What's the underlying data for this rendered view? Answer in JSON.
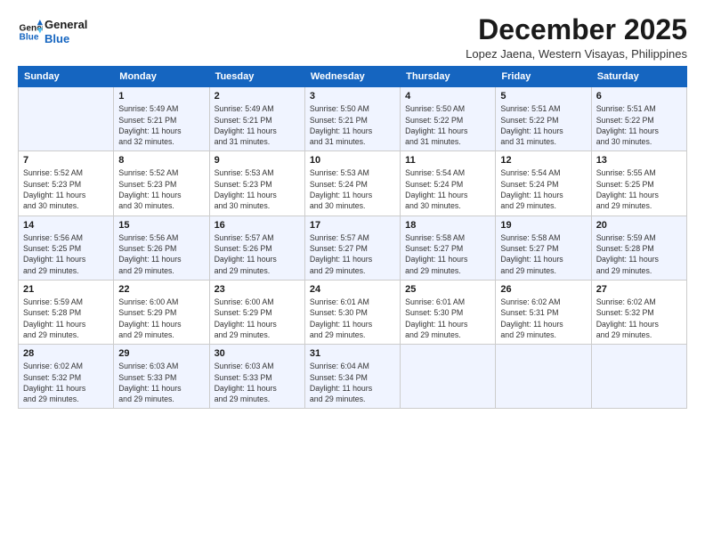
{
  "header": {
    "logo_line1": "General",
    "logo_line2": "Blue",
    "main_title": "December 2025",
    "subtitle": "Lopez Jaena, Western Visayas, Philippines"
  },
  "calendar": {
    "days_of_week": [
      "Sunday",
      "Monday",
      "Tuesday",
      "Wednesday",
      "Thursday",
      "Friday",
      "Saturday"
    ],
    "weeks": [
      [
        {
          "day": "",
          "info": ""
        },
        {
          "day": "1",
          "info": "Sunrise: 5:49 AM\nSunset: 5:21 PM\nDaylight: 11 hours\nand 32 minutes."
        },
        {
          "day": "2",
          "info": "Sunrise: 5:49 AM\nSunset: 5:21 PM\nDaylight: 11 hours\nand 31 minutes."
        },
        {
          "day": "3",
          "info": "Sunrise: 5:50 AM\nSunset: 5:21 PM\nDaylight: 11 hours\nand 31 minutes."
        },
        {
          "day": "4",
          "info": "Sunrise: 5:50 AM\nSunset: 5:22 PM\nDaylight: 11 hours\nand 31 minutes."
        },
        {
          "day": "5",
          "info": "Sunrise: 5:51 AM\nSunset: 5:22 PM\nDaylight: 11 hours\nand 31 minutes."
        },
        {
          "day": "6",
          "info": "Sunrise: 5:51 AM\nSunset: 5:22 PM\nDaylight: 11 hours\nand 30 minutes."
        }
      ],
      [
        {
          "day": "7",
          "info": "Sunrise: 5:52 AM\nSunset: 5:23 PM\nDaylight: 11 hours\nand 30 minutes."
        },
        {
          "day": "8",
          "info": "Sunrise: 5:52 AM\nSunset: 5:23 PM\nDaylight: 11 hours\nand 30 minutes."
        },
        {
          "day": "9",
          "info": "Sunrise: 5:53 AM\nSunset: 5:23 PM\nDaylight: 11 hours\nand 30 minutes."
        },
        {
          "day": "10",
          "info": "Sunrise: 5:53 AM\nSunset: 5:24 PM\nDaylight: 11 hours\nand 30 minutes."
        },
        {
          "day": "11",
          "info": "Sunrise: 5:54 AM\nSunset: 5:24 PM\nDaylight: 11 hours\nand 30 minutes."
        },
        {
          "day": "12",
          "info": "Sunrise: 5:54 AM\nSunset: 5:24 PM\nDaylight: 11 hours\nand 29 minutes."
        },
        {
          "day": "13",
          "info": "Sunrise: 5:55 AM\nSunset: 5:25 PM\nDaylight: 11 hours\nand 29 minutes."
        }
      ],
      [
        {
          "day": "14",
          "info": "Sunrise: 5:56 AM\nSunset: 5:25 PM\nDaylight: 11 hours\nand 29 minutes."
        },
        {
          "day": "15",
          "info": "Sunrise: 5:56 AM\nSunset: 5:26 PM\nDaylight: 11 hours\nand 29 minutes."
        },
        {
          "day": "16",
          "info": "Sunrise: 5:57 AM\nSunset: 5:26 PM\nDaylight: 11 hours\nand 29 minutes."
        },
        {
          "day": "17",
          "info": "Sunrise: 5:57 AM\nSunset: 5:27 PM\nDaylight: 11 hours\nand 29 minutes."
        },
        {
          "day": "18",
          "info": "Sunrise: 5:58 AM\nSunset: 5:27 PM\nDaylight: 11 hours\nand 29 minutes."
        },
        {
          "day": "19",
          "info": "Sunrise: 5:58 AM\nSunset: 5:27 PM\nDaylight: 11 hours\nand 29 minutes."
        },
        {
          "day": "20",
          "info": "Sunrise: 5:59 AM\nSunset: 5:28 PM\nDaylight: 11 hours\nand 29 minutes."
        }
      ],
      [
        {
          "day": "21",
          "info": "Sunrise: 5:59 AM\nSunset: 5:28 PM\nDaylight: 11 hours\nand 29 minutes."
        },
        {
          "day": "22",
          "info": "Sunrise: 6:00 AM\nSunset: 5:29 PM\nDaylight: 11 hours\nand 29 minutes."
        },
        {
          "day": "23",
          "info": "Sunrise: 6:00 AM\nSunset: 5:29 PM\nDaylight: 11 hours\nand 29 minutes."
        },
        {
          "day": "24",
          "info": "Sunrise: 6:01 AM\nSunset: 5:30 PM\nDaylight: 11 hours\nand 29 minutes."
        },
        {
          "day": "25",
          "info": "Sunrise: 6:01 AM\nSunset: 5:30 PM\nDaylight: 11 hours\nand 29 minutes."
        },
        {
          "day": "26",
          "info": "Sunrise: 6:02 AM\nSunset: 5:31 PM\nDaylight: 11 hours\nand 29 minutes."
        },
        {
          "day": "27",
          "info": "Sunrise: 6:02 AM\nSunset: 5:32 PM\nDaylight: 11 hours\nand 29 minutes."
        }
      ],
      [
        {
          "day": "28",
          "info": "Sunrise: 6:02 AM\nSunset: 5:32 PM\nDaylight: 11 hours\nand 29 minutes."
        },
        {
          "day": "29",
          "info": "Sunrise: 6:03 AM\nSunset: 5:33 PM\nDaylight: 11 hours\nand 29 minutes."
        },
        {
          "day": "30",
          "info": "Sunrise: 6:03 AM\nSunset: 5:33 PM\nDaylight: 11 hours\nand 29 minutes."
        },
        {
          "day": "31",
          "info": "Sunrise: 6:04 AM\nSunset: 5:34 PM\nDaylight: 11 hours\nand 29 minutes."
        },
        {
          "day": "",
          "info": ""
        },
        {
          "day": "",
          "info": ""
        },
        {
          "day": "",
          "info": ""
        }
      ]
    ]
  }
}
